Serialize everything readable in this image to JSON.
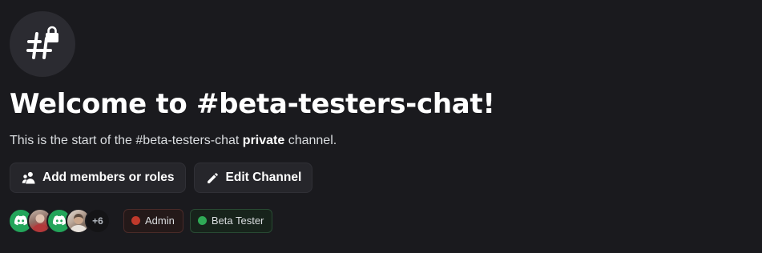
{
  "channel": {
    "icon": "hashtag-lock-icon",
    "welcome_title": "Welcome to #beta-testers-chat!",
    "description_prefix": "This is the start of the #beta-testers-chat ",
    "description_bold": "private",
    "description_suffix": " channel."
  },
  "actions": [
    {
      "label": "Add members or roles",
      "icon": "add-members-icon"
    },
    {
      "label": "Edit Channel",
      "icon": "pencil-icon"
    }
  ],
  "members": {
    "avatars": [
      "discord-logo-avatar",
      "photo-avatar",
      "discord-logo-avatar",
      "photo-avatar"
    ],
    "more_count": "+6"
  },
  "roles": [
    {
      "name": "Admin",
      "color": "#c0392b"
    },
    {
      "name": "Beta Tester",
      "color": "#2faa56"
    }
  ],
  "colors": {
    "background": "#1a1a1e",
    "button_bg": "#26262b",
    "green_avatar": "#23a55a"
  }
}
